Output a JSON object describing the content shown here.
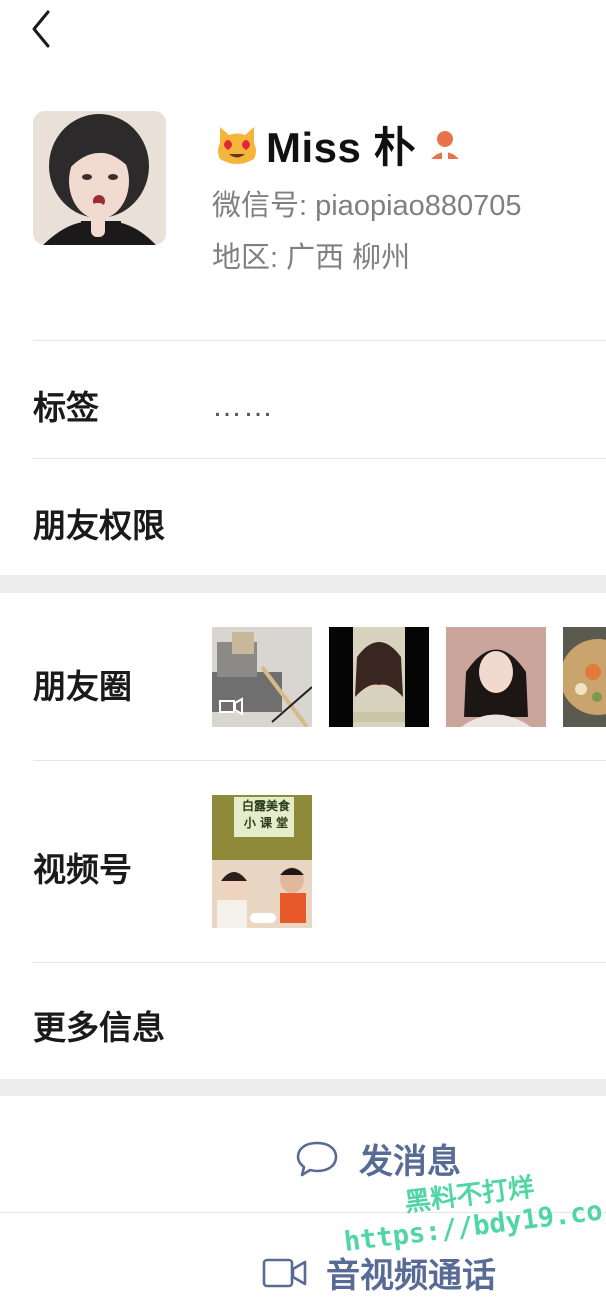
{
  "header": {
    "back_icon": "back-chevron-icon"
  },
  "profile": {
    "name": "Miss 朴",
    "name_emoji_icon": "heart-eyes-cat-icon",
    "badge_icon": "person-badge-icon",
    "wechat_id": "微信号: piaopiao880705",
    "region": "地区: 广西  柳州",
    "avatar_icon": "avatar-photo"
  },
  "rows": {
    "tags_label": "标签",
    "tags_value": "……",
    "permissions_label": "朋友权限",
    "moments_label": "朋友圈",
    "channels_label": "视频号",
    "more_info_label": "更多信息"
  },
  "moments": {
    "thumbnails": [
      "moment-photo-sofa",
      "moment-photo-selfie",
      "moment-photo-portrait",
      "moment-photo-food"
    ]
  },
  "channels": {
    "thumbnail_text_line1": "白露美食",
    "thumbnail_text_line2": "小 课 堂"
  },
  "actions": {
    "message_label": "发消息",
    "call_label": "音视频通话"
  },
  "watermark": {
    "line1": "黑料不打烊",
    "line2": "https://bdy19.co"
  },
  "colors": {
    "link": "#576b95",
    "gap": "#ededed",
    "badge": "#e8734a",
    "watermark": "#4fd6a2"
  }
}
